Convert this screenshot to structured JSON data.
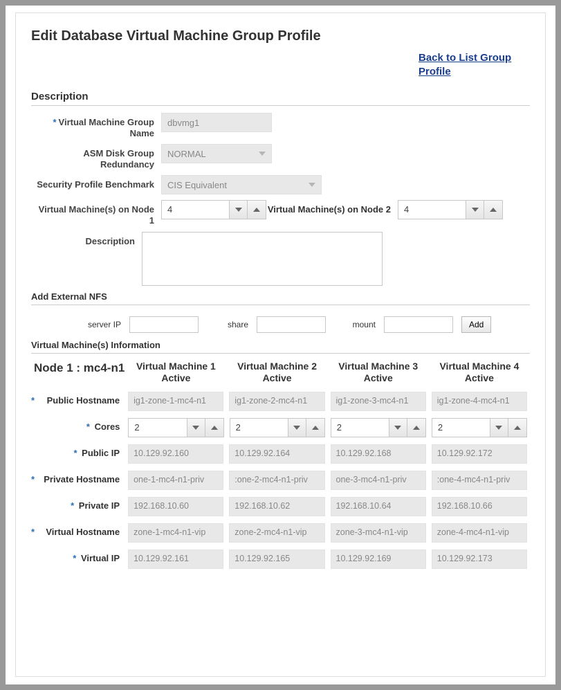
{
  "page": {
    "title": "Edit Database Virtual Machine Group Profile",
    "back_link": "Back to List Group Profile"
  },
  "sections": {
    "description": "Description",
    "add_nfs": "Add External NFS",
    "vm_info": "Virtual Machine(s) Information"
  },
  "form": {
    "group_name_label": "Virtual Machine Group Name",
    "group_name_value": "dbvmg1",
    "asm_label": "ASM Disk Group Redundancy",
    "asm_value": "NORMAL",
    "security_label": "Security Profile Benchmark",
    "security_value": "CIS Equivalent",
    "vm_node1_label": "Virtual Machine(s) on Node 1",
    "vm_node1_value": "4",
    "vm_node2_label": "Virtual Machine(s) on Node 2",
    "vm_node2_value": "4",
    "description_label": "Description",
    "description_value": ""
  },
  "nfs": {
    "server_ip_label": "server IP",
    "share_label": "share",
    "mount_label": "mount",
    "add_label": "Add"
  },
  "node": {
    "title": "Node 1 : mc4-n1",
    "columns": [
      "Virtual Machine 1 Active",
      "Virtual Machine 2 Active",
      "Virtual Machine 3 Active",
      "Virtual Machine 4 Active"
    ],
    "rows": {
      "public_hostname": {
        "label": "Public Hostname",
        "v1": "ig1-zone-1-mc4-n1",
        "v2": "ig1-zone-2-mc4-n1",
        "v3": "ig1-zone-3-mc4-n1",
        "v4": "ig1-zone-4-mc4-n1"
      },
      "cores": {
        "label": "Cores",
        "v1": "2",
        "v2": "2",
        "v3": "2",
        "v4": "2"
      },
      "public_ip": {
        "label": "Public IP",
        "v1": "10.129.92.160",
        "v2": "10.129.92.164",
        "v3": "10.129.92.168",
        "v4": "10.129.92.172"
      },
      "private_hostname": {
        "label": "Private Hostname",
        "v1": "one-1-mc4-n1-priv",
        "v2": ":one-2-mc4-n1-priv",
        "v3": "one-3-mc4-n1-priv",
        "v4": ":one-4-mc4-n1-priv"
      },
      "private_ip": {
        "label": "Private IP",
        "v1": "192.168.10.60",
        "v2": "192.168.10.62",
        "v3": "192.168.10.64",
        "v4": "192.168.10.66"
      },
      "virtual_hostname": {
        "label": "Virtual Hostname",
        "v1": "zone-1-mc4-n1-vip",
        "v2": "zone-2-mc4-n1-vip",
        "v3": "zone-3-mc4-n1-vip",
        "v4": "zone-4-mc4-n1-vip"
      },
      "virtual_ip": {
        "label": "Virtual IP",
        "v1": "10.129.92.161",
        "v2": "10.129.92.165",
        "v3": "10.129.92.169",
        "v4": "10.129.92.173"
      }
    }
  }
}
